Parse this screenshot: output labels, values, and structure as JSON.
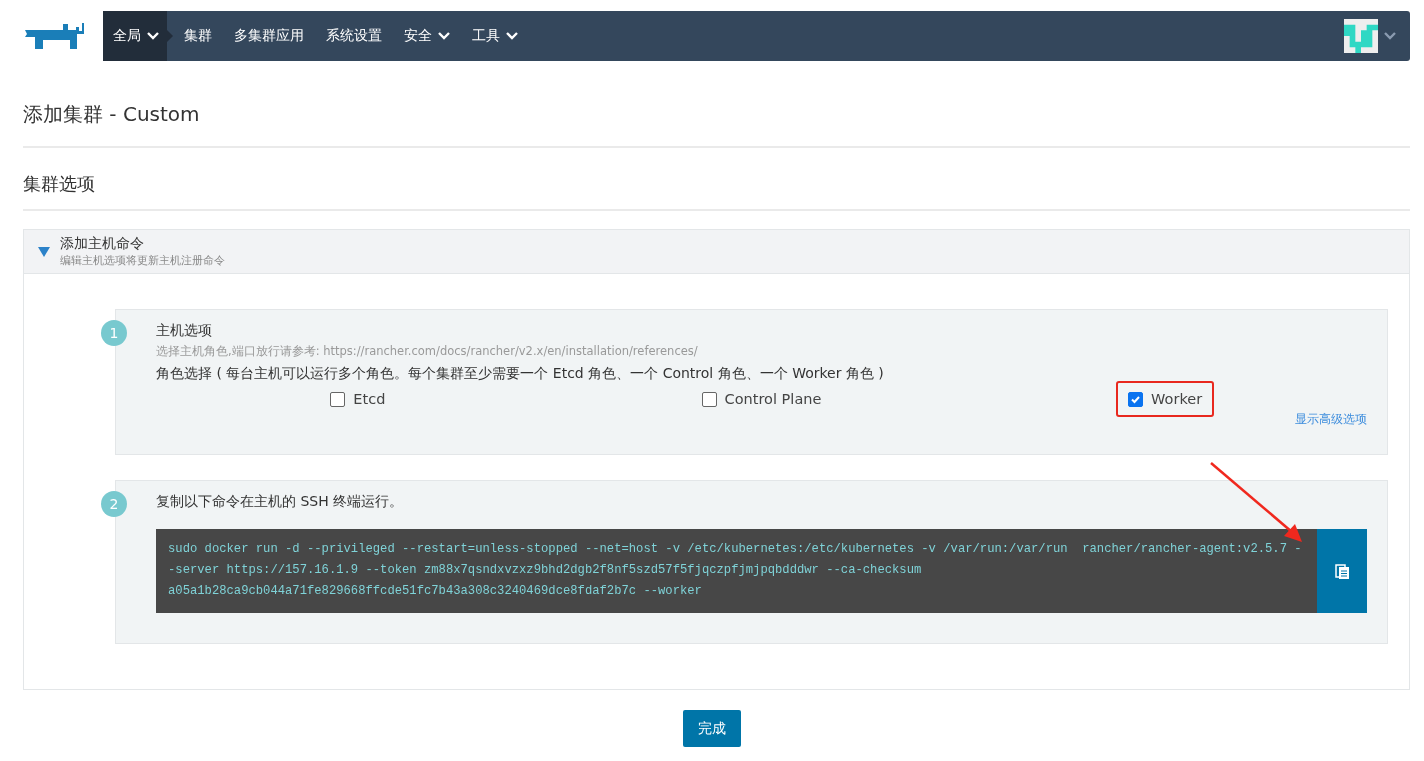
{
  "nav": {
    "items": [
      {
        "label": "全局",
        "dropdown": true,
        "selected": true
      },
      {
        "label": "集群",
        "dropdown": false,
        "selected": false
      },
      {
        "label": "多集群应用",
        "dropdown": false,
        "selected": false
      },
      {
        "label": "系统设置",
        "dropdown": false,
        "selected": false
      },
      {
        "label": "安全",
        "dropdown": true,
        "selected": false
      },
      {
        "label": "工具",
        "dropdown": true,
        "selected": false
      }
    ]
  },
  "page_title": "添加集群 - Custom",
  "section_title": "集群选项",
  "panel": {
    "title": "添加主机命令",
    "subtitle": "编辑主机选项将更新主机注册命令",
    "expanded": true,
    "steps": [
      {
        "kind": "options",
        "number": "1",
        "title": "主机选项",
        "hint": "选择主机角色,端口放行请参考: https://rancher.com/docs/rancher/v2.x/en/installation/references/",
        "roles_label": "角色选择 ( 每台主机可以运行多个角色。每个集群至少需要一个 Etcd 角色、一个 Control 角色、一个 Worker 角色 )",
        "roles": [
          {
            "label": "Etcd",
            "checked": false,
            "highlighted": false
          },
          {
            "label": "Control Plane",
            "checked": false,
            "highlighted": false
          },
          {
            "label": "Worker",
            "checked": true,
            "highlighted": true
          }
        ],
        "advanced_link": "显示高级选项"
      },
      {
        "kind": "command",
        "number": "2",
        "title": "复制以下命令在主机的 SSH 终端运行。",
        "command": "sudo docker run -d --privileged --restart=unless-stopped --net=host -v /etc/kubernetes:/etc/kubernetes -v /var/run:/var/run  rancher/rancher-agent:v2.5.7 --server https://157.16.1.9 --token zm88x7qsndxvzxz9bhd2dgb2f8nf5szd57f5fjqczpfjmjpqbdddwr --ca-checksum a05a1b28ca9cb044a71fe829668ffcde51fc7b43a308c3240469dce8fdaf2b7c --worker"
      }
    ]
  },
  "done_button": "完成"
}
